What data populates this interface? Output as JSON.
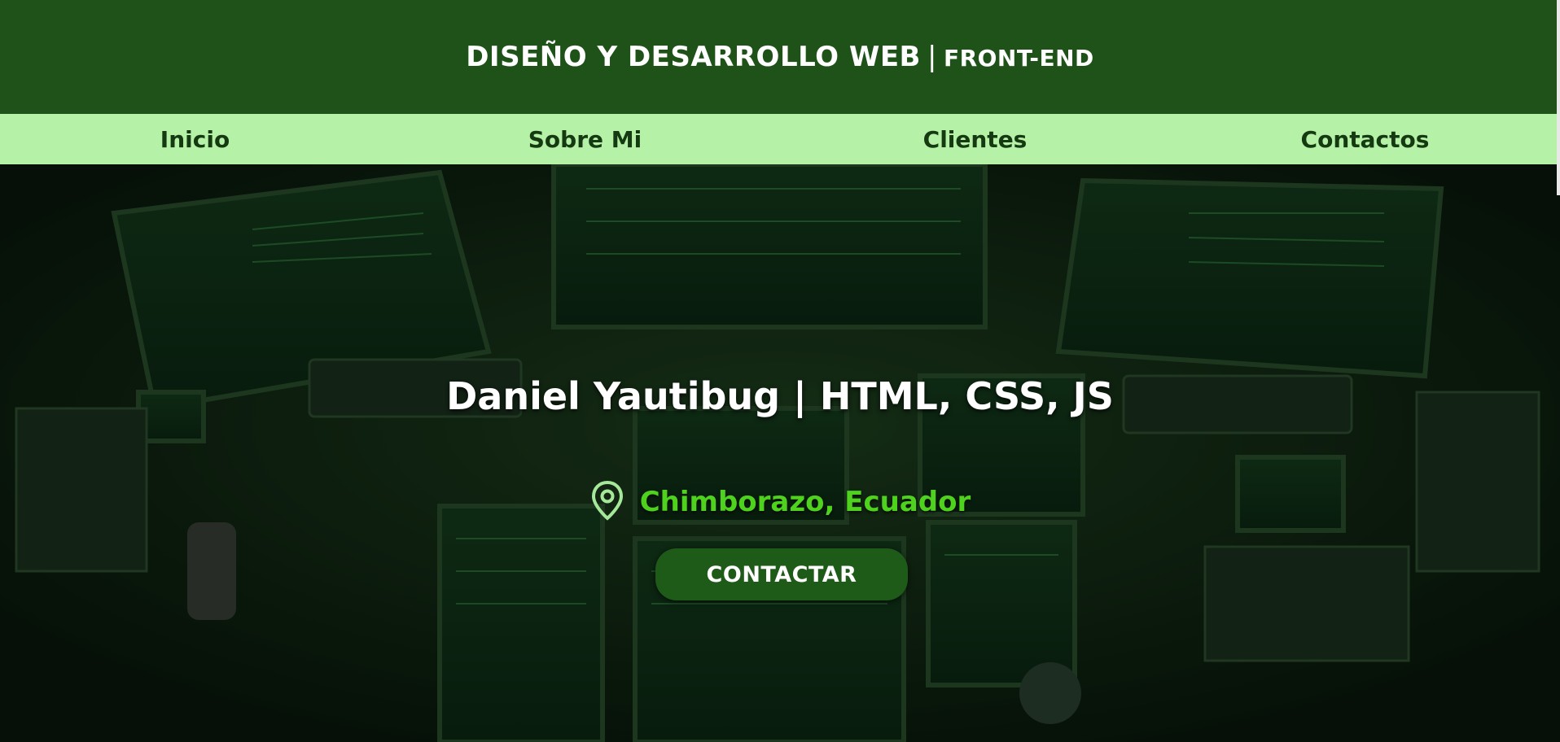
{
  "header": {
    "title_main": "DISEÑO Y DESARROLLO WEB",
    "separator": "|",
    "title_sub": "FRONT-END",
    "background_color": "#1e5218"
  },
  "nav": {
    "background_color": "#b5f1a6",
    "items": [
      {
        "label": "Inicio"
      },
      {
        "label": "Sobre Mi"
      },
      {
        "label": "Clientes"
      },
      {
        "label": "Contactos"
      }
    ]
  },
  "hero": {
    "title": "Daniel Yautibug | HTML, CSS, JS",
    "location_icon": "map-pin-icon",
    "location": "Chimborazo, Ecuador",
    "location_color": "#4fd21e",
    "cta_label": "CONTACTAR",
    "background_image": "dark-room-with-green-computer-monitors"
  }
}
